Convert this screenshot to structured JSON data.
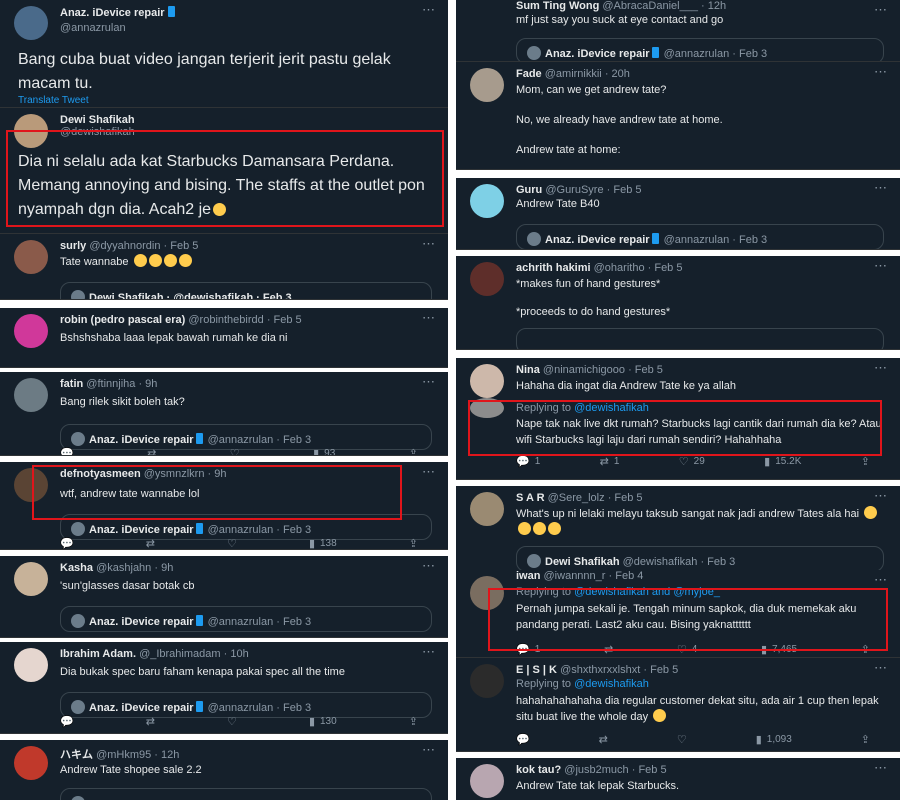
{
  "left": {
    "t1": {
      "name": "Anaz. iDevice repair",
      "handle": "@annazrulan",
      "text": "Bang cuba buat video jangan terjerit jerit pastu gelak macam tu.",
      "translate": "Translate Tweet"
    },
    "t2": {
      "name": "Dewi Shafikah",
      "handle": "@dewishafikah",
      "text": "Dia ni selalu ada kat Starbucks Damansara Perdana. Memang annoying and bising. The staffs at the outlet pon nyampah dgn dia. Acah2 je"
    },
    "t3": {
      "name": "surly",
      "handle": "@dyyahnordin",
      "time": "· Feb 5",
      "text": "Tate wannabe",
      "quote": "Dewi Shafikah · @dewishafikah · Feb 3"
    },
    "t4": {
      "name": "robin (pedro pascal era)",
      "handle": "@robinthebirdd",
      "time": "· Feb 5",
      "text": "Bshshshaba laaa lepak bawah rumah ke dia ni"
    },
    "t5": {
      "name": "fatin",
      "handle": "@ftinnjiha",
      "time": "· 9h",
      "text": "Bang rilek sikit boleh tak?",
      "quote_name": "Anaz. iDevice repair",
      "quote_meta": "@annazrulan · Feb 3",
      "views": "93"
    },
    "t6": {
      "name": "defnotyasmeen",
      "handle": "@ysmnzlkrn",
      "time": "· 9h",
      "text": "wtf, andrew tate wannabe lol",
      "quote_name": "Anaz. iDevice repair",
      "quote_meta": "@annazrulan · Feb 3",
      "views": "138"
    },
    "t7": {
      "name": "Kasha",
      "handle": "@kashjahn",
      "time": "· 9h",
      "text": "'sun'glasses dasar botak cb",
      "quote_name": "Anaz. iDevice repair",
      "quote_meta": "@annazrulan · Feb 3"
    },
    "t8": {
      "name": "Ibrahim Adam.",
      "handle": "@_Ibrahimadam",
      "time": "· 10h",
      "text": "Dia bukak spec baru faham kenapa pakai spec all the time",
      "quote_name": "Anaz. iDevice repair",
      "quote_meta": "@annazrulan · Feb 3",
      "views": "130"
    },
    "t9": {
      "name": "ハキム",
      "handle": "@mHkm95",
      "time": "· 12h",
      "text": "Andrew Tate shopee sale 2.2"
    }
  },
  "right": {
    "r1": {
      "name": "Sum Ting Wong",
      "handle": "@AbracaDaniel___",
      "time": "· 12h",
      "text": "mf just say you suck at eye contact and go",
      "quote_name": "Anaz. iDevice repair",
      "quote_meta": "@annazrulan · Feb 3"
    },
    "r2": {
      "name": "Fade",
      "handle": "@amirnikkii",
      "time": "· 20h",
      "line1": "Mom, can we get andrew tate?",
      "line2": "No, we already have andrew tate at home.",
      "line3": "Andrew tate at home:"
    },
    "r3": {
      "name": "Guru",
      "handle": "@GuruSyre",
      "time": "· Feb 5",
      "text": "Andrew Tate B40",
      "quote_name": "Anaz. iDevice repair",
      "quote_meta": "@annazrulan · Feb 3"
    },
    "r4": {
      "name": "achrith hakimi",
      "handle": "@oharitho",
      "time": "· Feb 5",
      "line1": "*makes fun of hand gestures*",
      "line2": "*proceeds to do hand gestures*"
    },
    "r5": {
      "name": "Nina",
      "handle": "@ninamichigooo",
      "time": "· Feb 5",
      "text": "Hahaha dia ingat dia Andrew Tate ke ya allah"
    },
    "r6": {
      "replying": "Replying to",
      "reply_to": "@dewishafikah",
      "text": "Nape tak nak live dkt rumah? Starbucks lagi cantik dari rumah dia ke? Atau wifi Starbucks lagi laju dari rumah sendiri? Hahahhaha",
      "replies": "1",
      "retweets": "1",
      "likes": "29",
      "views": "15.2K"
    },
    "r7": {
      "name": "S A R",
      "handle": "@Sere_lolz",
      "time": "· Feb 5",
      "text": "What's up ni lelaki melayu taksub sangat nak jadi andrew Tates ala hai",
      "quote_name": "Dewi Shafikah",
      "quote_meta": "@dewishafikah · Feb 3"
    },
    "r8": {
      "name": "iwan",
      "handle": "@iwannnn_r",
      "time": "· Feb 4",
      "replying": "Replying to",
      "reply_to": "@dewishafikah and @myjoe_",
      "text": "Pernah jumpa sekali je. Tengah minum sapkok, dia duk memekak aku pandang perati. Last2 aku cau. Bising yaknatttttt",
      "replies": "1",
      "likes": "4",
      "views": "7,465"
    },
    "r9": {
      "name": "E | S | K",
      "handle": "@shxthxrxxlshxt",
      "time": "· Feb 5",
      "replying": "Replying to",
      "reply_to": "@dewishafikah",
      "text": "hahahahahahaha dia regular customer dekat situ, ada air 1 cup then lepak situ buat live the whole day",
      "views": "1,093"
    },
    "r10": {
      "name": "kok tau?",
      "handle": "@jusb2much",
      "time": "· Feb 5",
      "text": "Andrew Tate tak lepak Starbucks."
    }
  },
  "icons": {
    "more": "⋯"
  }
}
